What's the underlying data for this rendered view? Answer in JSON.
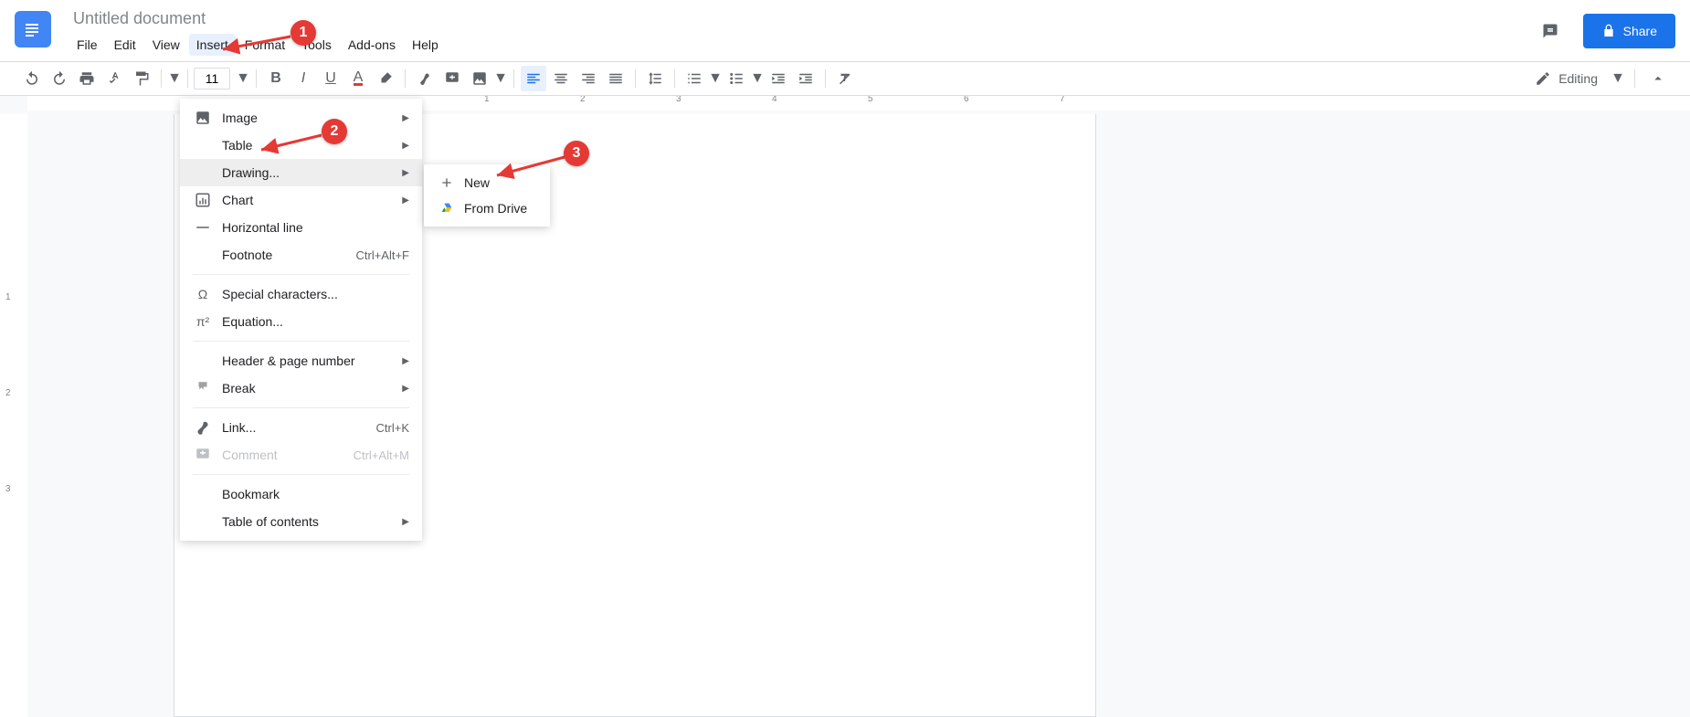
{
  "header": {
    "doc_title": "Untitled document",
    "menus": {
      "file": "File",
      "edit": "Edit",
      "view": "View",
      "insert": "Insert",
      "format": "Format",
      "tools": "Tools",
      "addons": "Add-ons",
      "help": "Help"
    },
    "share_label": "Share"
  },
  "toolbar": {
    "font_size": "11",
    "editing_label": "Editing"
  },
  "ruler": {
    "h_marks": [
      "1",
      "2",
      "3",
      "4",
      "5",
      "6",
      "7"
    ],
    "v_marks": [
      "1",
      "2",
      "3"
    ]
  },
  "insert_menu": {
    "image": "Image",
    "table": "Table",
    "drawing": "Drawing...",
    "chart": "Chart",
    "hline": "Horizontal line",
    "footnote": "Footnote",
    "footnote_sc": "Ctrl+Alt+F",
    "special": "Special characters...",
    "equation": "Equation...",
    "header_page": "Header & page number",
    "break": "Break",
    "link": "Link...",
    "link_sc": "Ctrl+K",
    "comment": "Comment",
    "comment_sc": "Ctrl+Alt+M",
    "bookmark": "Bookmark",
    "toc": "Table of contents"
  },
  "drawing_submenu": {
    "new": "New",
    "from_drive": "From Drive"
  },
  "callouts": {
    "c1": "1",
    "c2": "2",
    "c3": "3"
  }
}
